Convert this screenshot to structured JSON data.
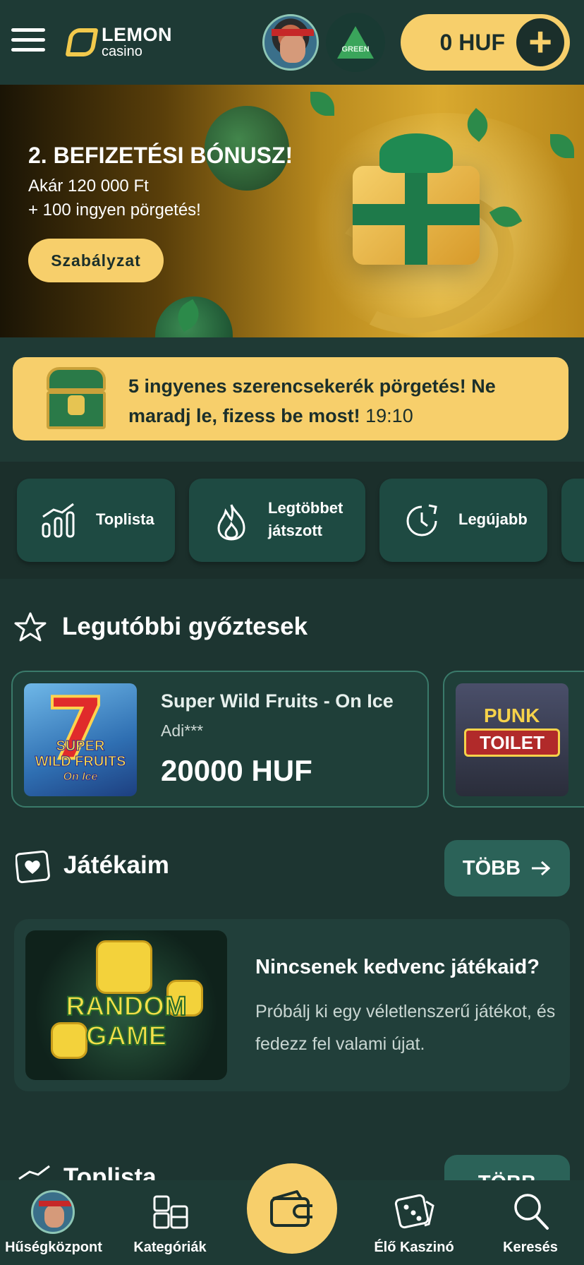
{
  "header": {
    "logo_line1": "LEMON",
    "logo_line2": "casino",
    "green_badge": "GREEN",
    "balance": "0 HUF"
  },
  "banner": {
    "title": "2. BEFIZETÉSI BÓNUSZ!",
    "line1": "Akár 120 000 Ft",
    "line2": "+ 100 ingyen pörgetés!",
    "button": "Szabályzat"
  },
  "promo": {
    "text": "5 ingyenes szerencsekerék pörgetés! Ne maradj le, fizess be most!",
    "timer": "19:10"
  },
  "categories": [
    {
      "label": "Toplista",
      "icon": "chart-bars-icon"
    },
    {
      "label": "Legtöbbet játszott",
      "icon": "flame-icon"
    },
    {
      "label": "Legújabb",
      "icon": "clock-icon"
    }
  ],
  "winners": {
    "title": "Legutóbbi győztesek",
    "items": [
      {
        "game": "Super Wild Fruits - On Ice",
        "user": "Adi***",
        "amount": "20000 HUF",
        "thumb_text": [
          "SUPER",
          "WILD FRUITS",
          "On Ice"
        ]
      },
      {
        "thumb_text": [
          "PUNK",
          "TOILET"
        ]
      }
    ]
  },
  "favorites": {
    "title": "Játékaim",
    "more": "TÖBB",
    "empty_title": "Nincsenek kedvenc játékaid?",
    "empty_text": "Próbálj ki egy véletlenszerű játékot, és fedezz fel valami újat.",
    "random_game": [
      "RANDOM",
      "GAME"
    ]
  },
  "toplist": {
    "title": "Toplista",
    "more": "TÖBB"
  },
  "bottom_nav": [
    {
      "label": "Hűségközpont"
    },
    {
      "label": "Kategóriák"
    },
    {
      "label": "Élő Kaszinó"
    },
    {
      "label": "Keresés"
    }
  ],
  "colors": {
    "accent_yellow": "#f7cf6b",
    "bg_dark": "#1b2f2b",
    "card_teal": "#1e4a42"
  }
}
